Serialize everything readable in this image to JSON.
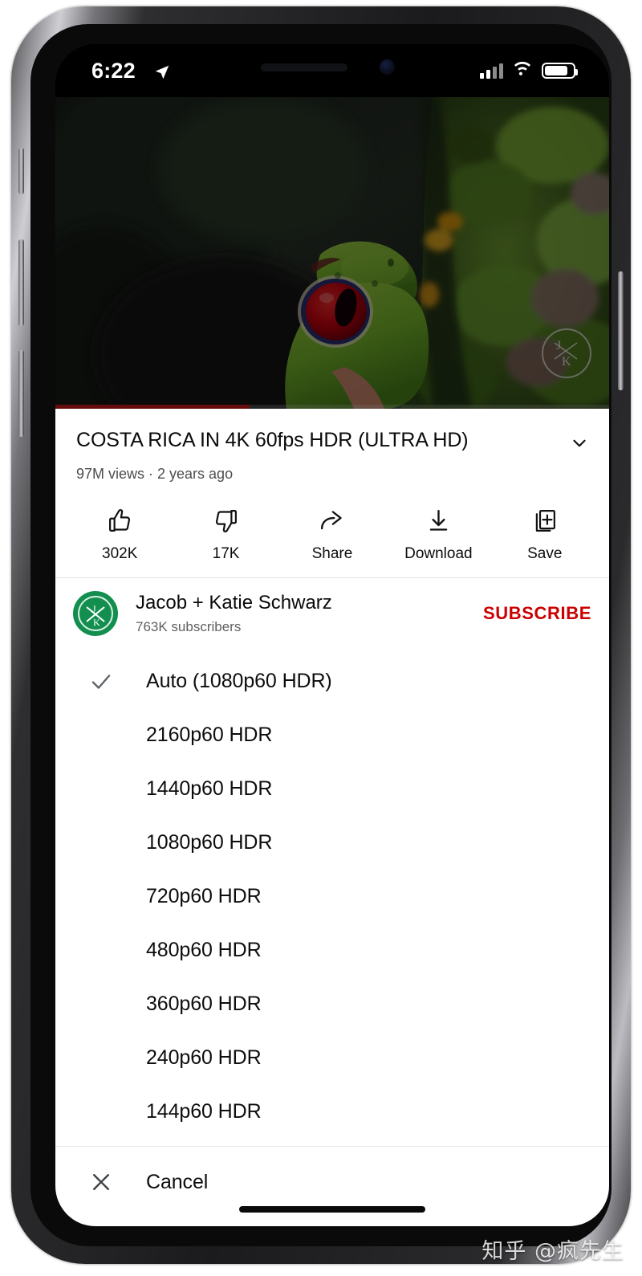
{
  "status_bar": {
    "time": "6:22",
    "location_icon": "location-arrow-icon",
    "cellular_icon": "cellular-signal-icon",
    "wifi_icon": "wifi-icon",
    "battery_icon": "battery-icon"
  },
  "video": {
    "title": "COSTA RICA IN 4K 60fps HDR (ULTRA HD)",
    "stats": "97M views · 2 years ago",
    "progress_percent": 35,
    "watermark_initials": "J K",
    "collapse_icon": "chevron-down-icon"
  },
  "actions": [
    {
      "label": "302K",
      "icon": "thumbs-up-icon",
      "name": "like-button"
    },
    {
      "label": "17K",
      "icon": "thumbs-down-icon",
      "name": "dislike-button"
    },
    {
      "label": "Share",
      "icon": "share-arrow-icon",
      "name": "share-button"
    },
    {
      "label": "Download",
      "icon": "download-icon",
      "name": "download-button"
    },
    {
      "label": "Save",
      "icon": "save-plus-icon",
      "name": "save-button"
    }
  ],
  "channel": {
    "name": "Jacob + Katie Schwarz",
    "subscribers": "763K subscribers",
    "subscribe_label": "SUBSCRIBE",
    "avatar_initials": "J K",
    "avatar_color": "#128f4f",
    "subscribe_color": "#cc0000"
  },
  "quality_sheet": {
    "selected_index": 0,
    "check_icon": "checkmark-icon",
    "items": [
      "Auto (1080p60 HDR)",
      "2160p60 HDR",
      "1440p60 HDR",
      "1080p60 HDR",
      "720p60 HDR",
      "480p60 HDR",
      "360p60 HDR",
      "240p60 HDR",
      "144p60 HDR"
    ],
    "cancel_label": "Cancel",
    "cancel_icon": "close-x-icon"
  },
  "watermark": {
    "text": "知乎 @疯先生"
  },
  "colors": {
    "progress_red": "#d61b1b",
    "sheet_background": "#ffffff",
    "dim_overlay": "rgba(0,0,0,0.52)"
  }
}
